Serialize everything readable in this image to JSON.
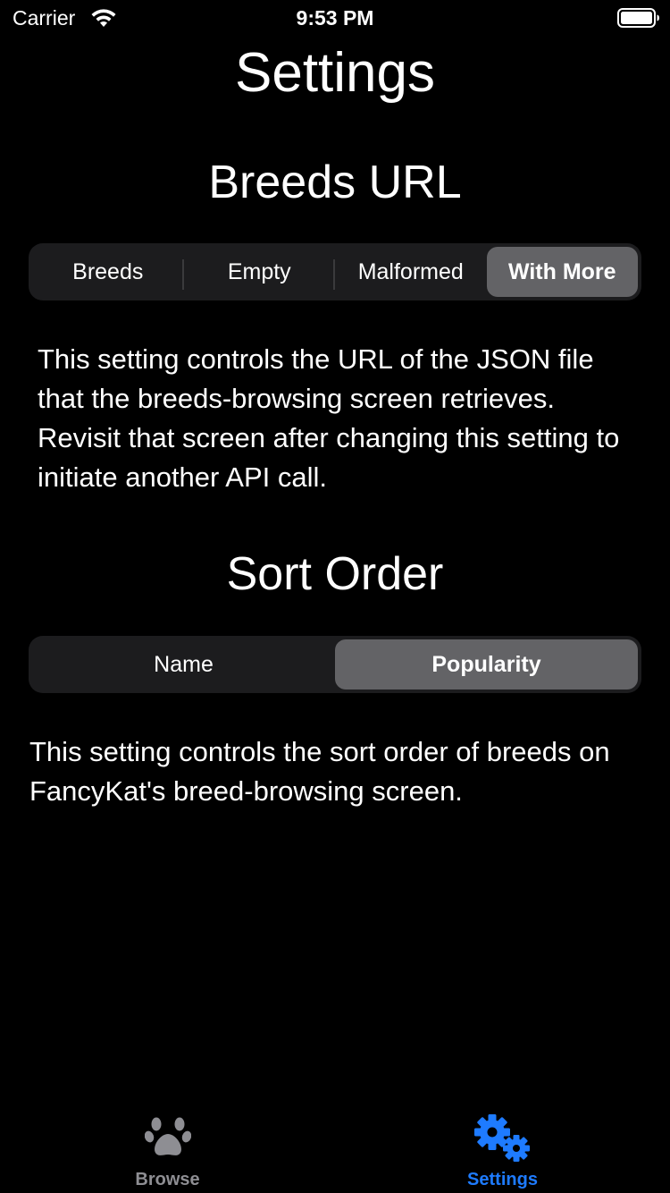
{
  "status_bar": {
    "carrier": "Carrier",
    "time": "9:53 PM",
    "icons": [
      "wifi-icon",
      "battery-icon"
    ]
  },
  "page": {
    "title": "Settings"
  },
  "breeds_url": {
    "heading": "Breeds URL",
    "options": [
      "Breeds",
      "Empty",
      "Malformed",
      "With More"
    ],
    "selected": "With More",
    "description": "This setting controls the URL of the JSON file that the breeds-browsing screen retrieves. Revisit that screen after changing this setting to initiate another API call."
  },
  "sort_order": {
    "heading": "Sort Order",
    "options": [
      "Name",
      "Popularity"
    ],
    "selected": "Popularity",
    "description": "This setting controls the sort order of breeds on FancyKat's breed-browsing screen."
  },
  "tab_bar": {
    "items": [
      {
        "label": "Browse",
        "icon": "paw-icon",
        "active": false
      },
      {
        "label": "Settings",
        "icon": "gears-icon",
        "active": true
      }
    ]
  },
  "colors": {
    "background": "#000000",
    "segment_track": "#1c1c1e",
    "segment_selected": "#636366",
    "tab_active": "#1e7bff",
    "tab_inactive": "#8e8e93"
  }
}
